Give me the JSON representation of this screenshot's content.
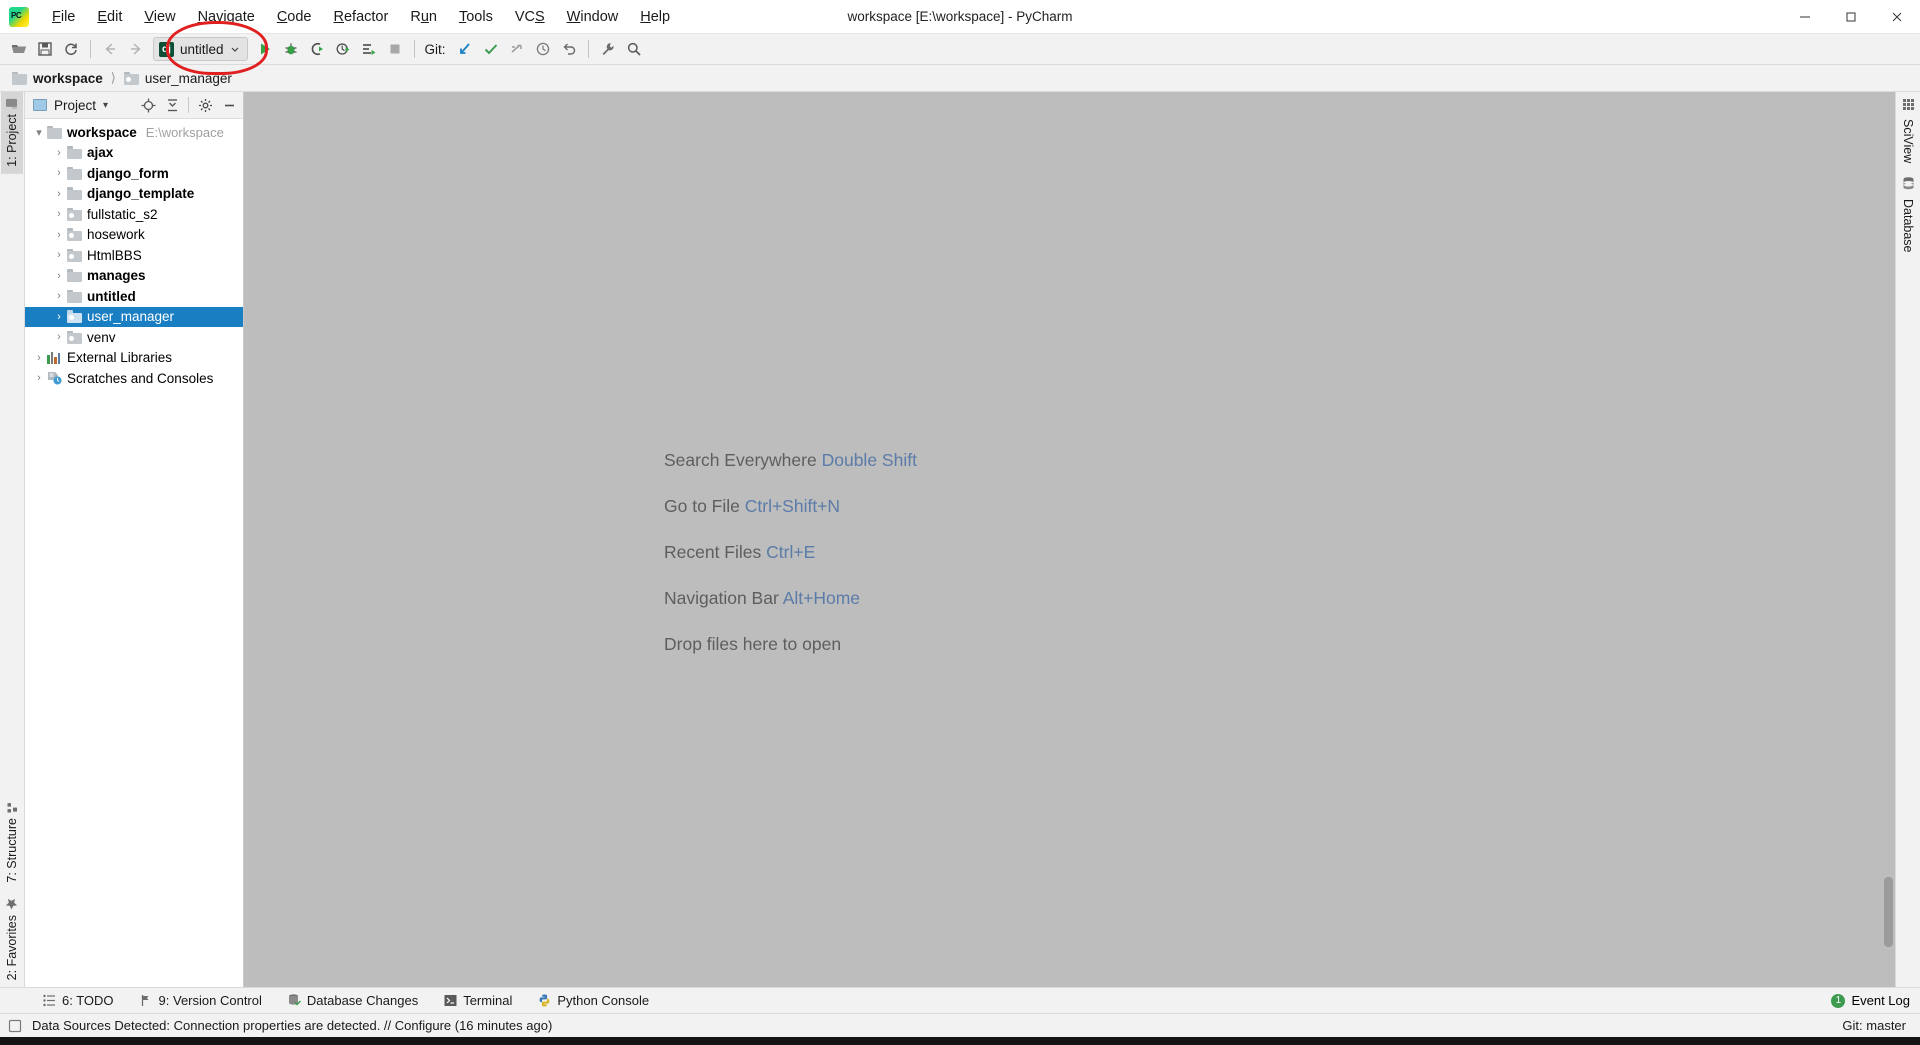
{
  "window": {
    "title": "workspace [E:\\workspace] - PyCharm",
    "minimize": "–",
    "maximize": "❐",
    "close": "✕"
  },
  "menubar": [
    {
      "label": "File",
      "mnemonic": "F"
    },
    {
      "label": "Edit",
      "mnemonic": "E"
    },
    {
      "label": "View",
      "mnemonic": "V"
    },
    {
      "label": "Navigate",
      "mnemonic": "N"
    },
    {
      "label": "Code",
      "mnemonic": "C"
    },
    {
      "label": "Refactor",
      "mnemonic": "R"
    },
    {
      "label": "Run",
      "mnemonic": "u"
    },
    {
      "label": "Tools",
      "mnemonic": "T"
    },
    {
      "label": "VCS",
      "mnemonic": "S"
    },
    {
      "label": "Window",
      "mnemonic": "W"
    },
    {
      "label": "Help",
      "mnemonic": "H"
    }
  ],
  "toolbar": {
    "open_icon": "open-folder-icon",
    "save_icon": "save-icon",
    "sync_icon": "refresh-icon",
    "back_icon": "back-arrow-icon",
    "forward_icon": "forward-arrow-icon",
    "run_config": {
      "name": "untitled",
      "badge": "dj",
      "chevron": "⌄"
    },
    "run_icon": "run-icon",
    "debug_icon": "debug-icon",
    "run_coverage_icon": "run-with-coverage-icon",
    "profile_icon": "profile-icon",
    "run_dashboard_icon": "run-dashboard-icon",
    "stop_icon": "stop-icon",
    "git_label": "Git:",
    "update_icon": "update-project-icon",
    "commit_icon": "commit-icon",
    "push_icon": "push-icon",
    "history_icon": "history-icon",
    "revert_icon": "revert-icon",
    "settings_icon": "settings-wrench-icon",
    "search_icon": "search-icon"
  },
  "annotation": {
    "shape": "red-ellipse-highlight",
    "target": "run-configuration-selector"
  },
  "breadcrumb": [
    {
      "label": "workspace",
      "bold": true,
      "icon": "folder-icon"
    },
    {
      "label": "user_manager",
      "bold": false,
      "icon": "module-folder-icon"
    }
  ],
  "left_strip": {
    "tabs": [
      {
        "label": "1: Project",
        "mnemonic": "1",
        "icon": "project-icon",
        "active": true
      },
      {
        "label": "7: Structure",
        "mnemonic": "7",
        "icon": "structure-icon",
        "active": false
      },
      {
        "label": "2: Favorites",
        "mnemonic": "2",
        "icon": "star-icon",
        "active": false
      }
    ]
  },
  "right_strip": {
    "tabs": [
      {
        "label": "SciView",
        "icon": "grid-icon"
      },
      {
        "label": "Database",
        "icon": "database-icon"
      }
    ]
  },
  "project_panel": {
    "title": "Project",
    "title_icon": "project-window-icon",
    "dropdown": "▾",
    "icons": [
      {
        "name": "locate-target-icon",
        "glyph": "⊕"
      },
      {
        "name": "collapse-all-icon",
        "glyph": "⤓"
      },
      {
        "name": "settings-gear-icon",
        "glyph": "⚙"
      },
      {
        "name": "hide-panel-icon",
        "glyph": "—"
      }
    ],
    "tree": [
      {
        "label": "workspace",
        "path": "E:\\workspace",
        "indent": 0,
        "bold": true,
        "twist": "v",
        "icon": "folder-icon",
        "selected": false
      },
      {
        "label": "ajax",
        "indent": 1,
        "bold": true,
        "twist": ">",
        "icon": "folder-icon",
        "selected": false
      },
      {
        "label": "django_form",
        "indent": 1,
        "bold": true,
        "twist": ">",
        "icon": "folder-icon",
        "selected": false
      },
      {
        "label": "django_template",
        "indent": 1,
        "bold": true,
        "twist": ">",
        "icon": "folder-icon",
        "selected": false
      },
      {
        "label": "fullstatic_s2",
        "indent": 1,
        "bold": false,
        "twist": ">",
        "icon": "module-folder-icon",
        "selected": false
      },
      {
        "label": "hosework",
        "indent": 1,
        "bold": false,
        "twist": ">",
        "icon": "module-folder-icon",
        "selected": false
      },
      {
        "label": "HtmlBBS",
        "indent": 1,
        "bold": false,
        "twist": ">",
        "icon": "module-folder-icon",
        "selected": false
      },
      {
        "label": "manages",
        "indent": 1,
        "bold": true,
        "twist": ">",
        "icon": "folder-icon",
        "selected": false
      },
      {
        "label": "untitled",
        "indent": 1,
        "bold": true,
        "twist": ">",
        "icon": "folder-icon",
        "selected": false
      },
      {
        "label": "user_manager",
        "indent": 1,
        "bold": false,
        "twist": ">",
        "icon": "module-folder-icon",
        "selected": true
      },
      {
        "label": "venv",
        "indent": 1,
        "bold": false,
        "twist": ">",
        "icon": "module-folder-icon",
        "selected": false
      },
      {
        "label": "External Libraries",
        "indent": 0,
        "bold": false,
        "twist": ">",
        "icon": "libraries-icon",
        "selected": false
      },
      {
        "label": "Scratches and Consoles",
        "indent": 0,
        "bold": false,
        "twist": ">",
        "icon": "scratches-icon",
        "selected": false
      }
    ]
  },
  "editor": {
    "welcome": [
      {
        "text": "Search Everywhere",
        "key": "Double Shift"
      },
      {
        "text": "Go to File",
        "key": "Ctrl+Shift+N"
      },
      {
        "text": "Recent Files",
        "key": "Ctrl+E"
      },
      {
        "text": "Navigation Bar",
        "key": "Alt+Home"
      },
      {
        "text": "Drop files here to open",
        "key": ""
      }
    ]
  },
  "bottom_bar": {
    "buttons": [
      {
        "label": "6: TODO",
        "mnemonic": "6",
        "icon": "todo-icon"
      },
      {
        "label": "9: Version Control",
        "mnemonic": "9",
        "icon": "version-control-icon"
      },
      {
        "label": "Database Changes",
        "mnemonic": "",
        "icon": "database-changes-icon"
      },
      {
        "label": "Terminal",
        "mnemonic": "",
        "icon": "terminal-icon"
      },
      {
        "label": "Python Console",
        "mnemonic": "",
        "icon": "python-console-icon"
      }
    ],
    "event_log": {
      "label": "Event Log",
      "count": "1"
    }
  },
  "status_bar": {
    "icon": "notification-icon",
    "message": "Data Sources Detected: Connection properties are detected. // Configure (16 minutes ago)",
    "right": "Git: master"
  },
  "colors": {
    "accent_blue": "#1a7ec2",
    "editor_bg": "#bdbdbd",
    "panel_bg": "#f2f2f2",
    "annotation_red": "#e02020",
    "link_blue": "#5b7ba8",
    "green": "#3d9b4f"
  }
}
